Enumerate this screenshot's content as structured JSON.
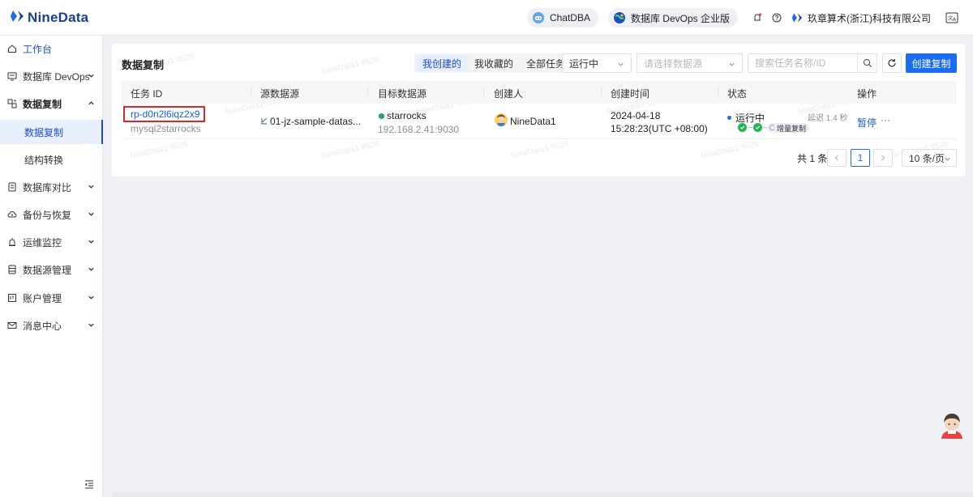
{
  "header": {
    "logo_text": "NineData",
    "chatdba_label": "ChatDBA",
    "devops_label": "数据库 DevOps 企业版",
    "company_name": "玖章算术(浙江)科技有限公司"
  },
  "sidebar": {
    "items": [
      {
        "label": "工作台"
      },
      {
        "label": "数据库 DevOps"
      },
      {
        "label": "数据复制"
      },
      {
        "label": "数据库对比"
      },
      {
        "label": "备份与恢复"
      },
      {
        "label": "运维监控"
      },
      {
        "label": "数据源管理"
      },
      {
        "label": "账户管理"
      },
      {
        "label": "消息中心"
      }
    ],
    "sub_items": [
      {
        "label": "数据复制"
      },
      {
        "label": "结构转换"
      }
    ]
  },
  "main": {
    "title": "数据复制",
    "filters": {
      "tabs": [
        {
          "label": "我创建的"
        },
        {
          "label": "我收藏的"
        },
        {
          "label": "全部任务"
        }
      ],
      "status_value": "运行中",
      "datasource_placeholder": "请选择数据源",
      "search_placeholder": "搜索任务名称/ID"
    },
    "create_label": "创建复制",
    "table": {
      "columns": [
        "任务 ID",
        "源数据源",
        "目标数据源",
        "创建人",
        "创建时间",
        "状态",
        "操作"
      ],
      "rows": [
        {
          "task_id": "rp-d0n2l6iqz2x9",
          "task_name": "mysql2starrocks",
          "source": "01-jz-sample-datas...",
          "target_name": "starrocks",
          "target_addr": "192.168.2.41:9030",
          "creator": "NineData1",
          "created_date": "2024-04-18",
          "created_time": "15:28:23(UTC +08:00)",
          "status": "运行中",
          "delay": "延迟 1.4 秒",
          "stage": "增量复制",
          "action_pause": "暂停",
          "action_more": "···"
        }
      ]
    },
    "pagination": {
      "total": "共 1 条",
      "current_page": "1",
      "page_size": "10 条/页"
    }
  },
  "watermark": "NineData1 9526",
  "colors": {
    "primary": "#1a6cf0",
    "brand": "#1c3f94",
    "highlight_box": "#e0242a",
    "success": "#22b359"
  }
}
